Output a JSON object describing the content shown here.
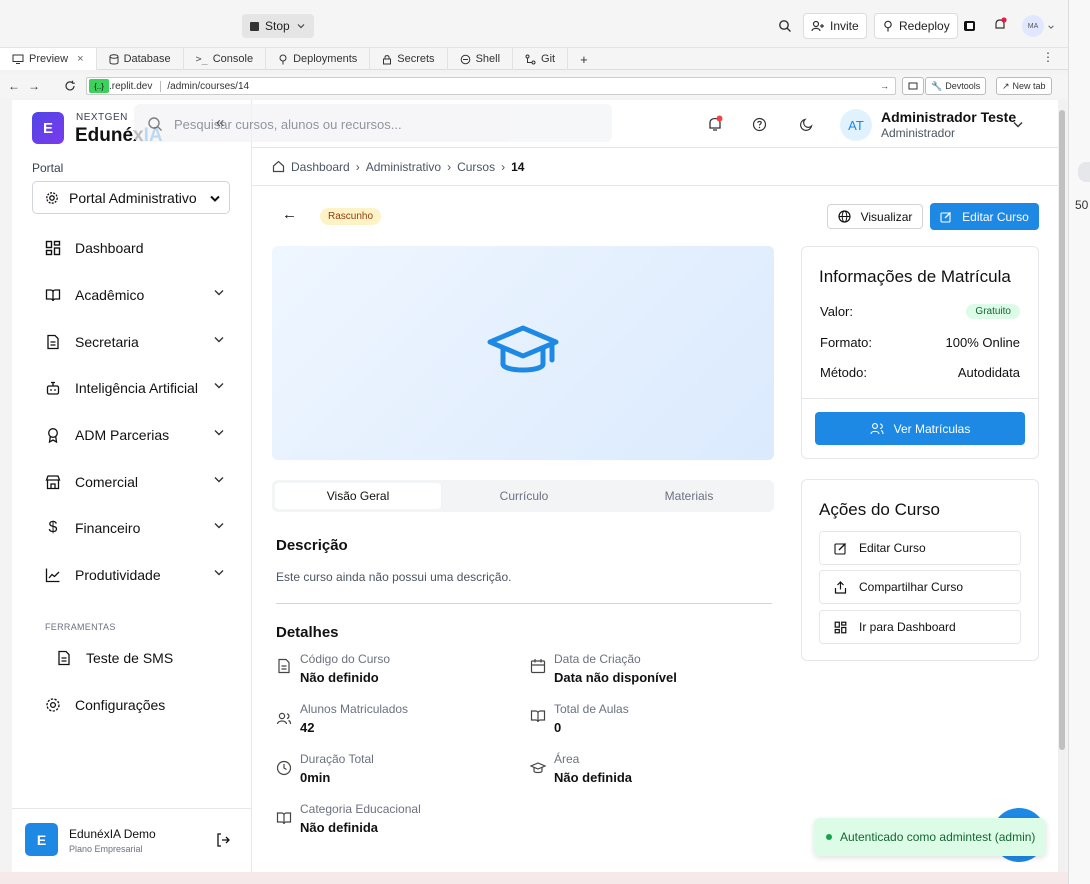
{
  "replit": {
    "stop_label": "Stop",
    "invite_label": "Invite",
    "redeploy_label": "Redeploy",
    "avatar_initials": "MA",
    "tabs": [
      {
        "label": "Preview",
        "icon": "monitor-icon"
      },
      {
        "label": "Database",
        "icon": "database-icon"
      },
      {
        "label": "Console",
        "icon": "terminal-icon"
      },
      {
        "label": "Deployments",
        "icon": "deploy-icon"
      },
      {
        "label": "Secrets",
        "icon": "lock-icon"
      },
      {
        "label": "Shell",
        "icon": "shell-icon"
      },
      {
        "label": "Git",
        "icon": "git-icon"
      }
    ],
    "url_domain": ".replit.dev",
    "url_path": "/admin/courses/14",
    "devtools_label": "Devtools",
    "newtab_label": "New tab",
    "side_count": "50"
  },
  "brand": {
    "logo_letter": "E",
    "tagline": "NEXTGEN",
    "name_main": "Edunéx",
    "name_accent": "IA"
  },
  "header": {
    "search_placeholder": "Pesquisar cursos, alunos ou recursos...",
    "user_initials": "AT",
    "user_name": "Administrador Teste",
    "user_role": "Administrador"
  },
  "sidebar": {
    "portal_label": "Portal",
    "portal_select": "Portal Administrativo",
    "items": [
      {
        "label": "Dashboard",
        "icon": "dashboard-icon"
      },
      {
        "label": "Acadêmico",
        "icon": "book-icon"
      },
      {
        "label": "Secretaria",
        "icon": "document-icon"
      },
      {
        "label": "Inteligência Artificial",
        "icon": "bot-icon"
      },
      {
        "label": "ADM Parcerias",
        "icon": "award-icon"
      },
      {
        "label": "Comercial",
        "icon": "store-icon"
      },
      {
        "label": "Financeiro",
        "icon": "dollar-icon"
      },
      {
        "label": "Produtividade",
        "icon": "chart-line-icon"
      }
    ],
    "tools_heading": "FERRAMENTAS",
    "tools_item": "Teste de SMS",
    "settings_label": "Configurações",
    "footer_initial": "E",
    "footer_name": "EdunéxIA Demo",
    "footer_plan": "Plano Empresarial"
  },
  "breadcrumb": [
    "Dashboard",
    "Administrativo",
    "Cursos",
    "14"
  ],
  "course": {
    "status_badge": "Rascunho",
    "view_button": "Visualizar",
    "edit_button": "Editar Curso",
    "tabs": [
      "Visão Geral",
      "Currículo",
      "Materiais"
    ],
    "description_heading": "Descrição",
    "description_text": "Este curso ainda não possui uma descrição.",
    "details_heading": "Detalhes",
    "details": [
      {
        "label": "Código do Curso",
        "value": "Não definido",
        "icon": "document-icon"
      },
      {
        "label": "Data de Criação",
        "value": "Data não disponível",
        "icon": "calendar-icon"
      },
      {
        "label": "Alunos Matriculados",
        "value": "42",
        "icon": "users-icon"
      },
      {
        "label": "Total de Aulas",
        "value": "0",
        "icon": "book-open-icon"
      },
      {
        "label": "Duração Total",
        "value": "0min",
        "icon": "clock-icon"
      },
      {
        "label": "Área",
        "value": "Não definida",
        "icon": "graduation-cap-icon"
      },
      {
        "label": "Categoria Educacional",
        "value": "Não definida",
        "icon": "book-open-icon"
      }
    ]
  },
  "enrollment": {
    "title": "Informações de Matrícula",
    "value_label": "Valor:",
    "value_badge": "Gratuito",
    "format_label": "Formato:",
    "format_value": "100% Online",
    "method_label": "Método:",
    "method_value": "Autodidata",
    "button": "Ver Matrículas"
  },
  "actions": {
    "title": "Ações do Curso",
    "items": [
      "Editar Curso",
      "Compartilhar Curso",
      "Ir para Dashboard"
    ]
  },
  "toast": "Autenticado como admintest (admin)",
  "colors": {
    "primary": "#1e88e5",
    "badge_yellow": "#fef3c7",
    "badge_green": "#dcfce7",
    "toast_bg": "#dcfce7"
  }
}
